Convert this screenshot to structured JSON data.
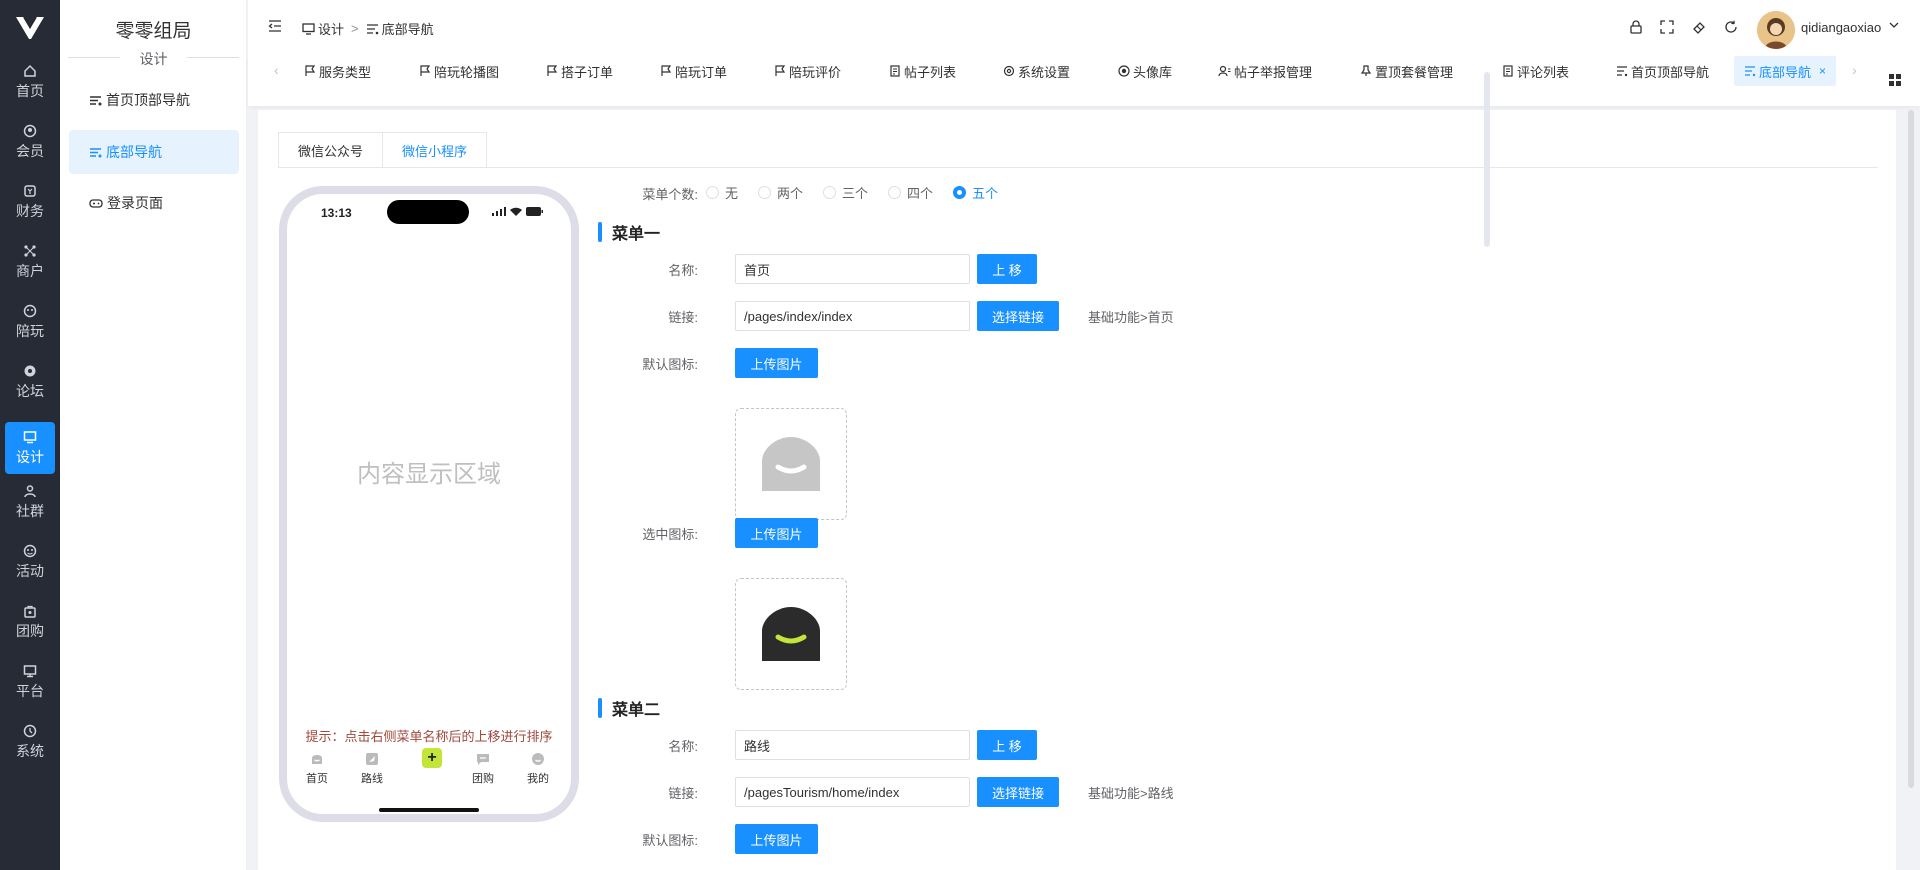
{
  "sidebar": {
    "items": [
      {
        "label": "首页",
        "icon": "home-icon"
      },
      {
        "label": "会员",
        "icon": "member-icon"
      },
      {
        "label": "财务",
        "icon": "finance-icon"
      },
      {
        "label": "商户",
        "icon": "merchant-icon"
      },
      {
        "label": "陪玩",
        "icon": "companion-icon"
      },
      {
        "label": "论坛",
        "icon": "forum-icon"
      },
      {
        "label": "设计",
        "icon": "design-icon",
        "active": true
      },
      {
        "label": "社群",
        "icon": "community-icon"
      },
      {
        "label": "活动",
        "icon": "activity-icon"
      },
      {
        "label": "团购",
        "icon": "group-buy-icon"
      },
      {
        "label": "平台",
        "icon": "platform-icon"
      },
      {
        "label": "系统",
        "icon": "system-icon"
      }
    ]
  },
  "subsidebar": {
    "title": "零零组局",
    "subtitle": "设计",
    "items": [
      {
        "label": "首页顶部导航"
      },
      {
        "label": "底部导航",
        "active": true
      },
      {
        "label": "登录页面"
      }
    ]
  },
  "header": {
    "breadcrumb": [
      "设计",
      "底部导航"
    ],
    "username": "qidiangaoxiao"
  },
  "tabs": [
    "服务类型",
    "陪玩轮播图",
    "搭子订单",
    "陪玩订单",
    "陪玩评价",
    "帖子列表",
    "系统设置",
    "头像库",
    "帖子举报管理",
    "置顶套餐管理",
    "评论列表",
    "首页顶部导航",
    "底部导航"
  ],
  "inner_tabs": [
    "微信公众号",
    "微信小程序"
  ],
  "phone": {
    "time": "13:13",
    "content_placeholder": "内容显示区域",
    "hint": "提示：点击右侧菜单名称后的上移进行排序",
    "tabbar": [
      "首页",
      "路线",
      "团购",
      "我的"
    ]
  },
  "form": {
    "menu_count_label": "菜单个数:",
    "menu_count_options": [
      "无",
      "两个",
      "三个",
      "四个",
      "五个"
    ],
    "menu_count_selected": "五个",
    "name_label": "名称:",
    "link_label": "链接:",
    "default_icon_label": "默认图标:",
    "selected_icon_label": "选中图标:",
    "move_up_label": "上 移",
    "choose_link_label": "选择链接",
    "upload_label": "上传图片",
    "menus": [
      {
        "title": "菜单一",
        "name": "首页",
        "link": "/pages/index/index",
        "link_desc": "基础功能>首页"
      },
      {
        "title": "菜单二",
        "name": "路线",
        "link": "/pagesTourism/home/index",
        "link_desc": "基础功能>路线"
      }
    ]
  },
  "colors": {
    "primary": "#1890ff",
    "sidebar_bg": "#262b35",
    "accent_green": "#c3e53a"
  }
}
